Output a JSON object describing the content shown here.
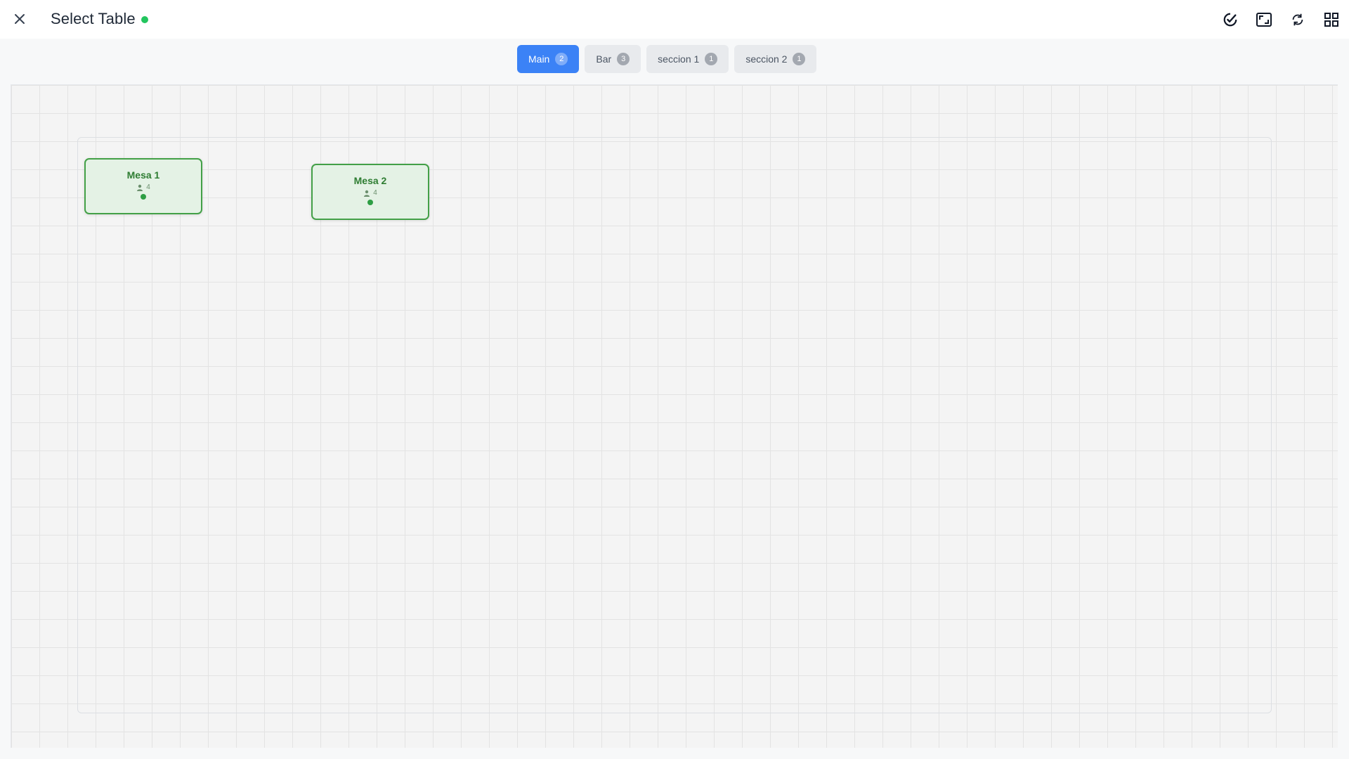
{
  "header": {
    "title": "Select Table",
    "status_color": "#22c55e"
  },
  "toolbar": {
    "icons": [
      "compass-check-icon",
      "fit-screen-icon",
      "refresh-icon",
      "grid-view-icon"
    ]
  },
  "tabs": [
    {
      "label": "Main",
      "count": "2",
      "active": true
    },
    {
      "label": "Bar",
      "count": "3",
      "active": false
    },
    {
      "label": "seccion 1",
      "count": "1",
      "active": false
    },
    {
      "label": "seccion 2",
      "count": "1",
      "active": false
    }
  ],
  "tables": [
    {
      "name": "Mesa 1",
      "seats": "4",
      "status": "available"
    },
    {
      "name": "Mesa 2",
      "seats": "4",
      "status": "available"
    }
  ],
  "colors": {
    "accent": "#3b82f6",
    "available_border": "#43a047",
    "available_fill": "#e4f2e5"
  }
}
